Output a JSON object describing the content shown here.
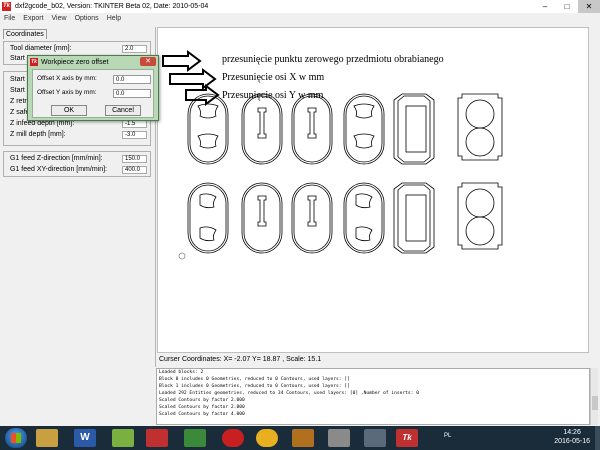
{
  "window": {
    "title": "dxf2gcode_b02, Version: TKINTER Beta 02, Date: 2010-05-04",
    "app_icon": "Tk",
    "minimize_icon": "–",
    "maximize_icon": "□",
    "close_icon": "✕"
  },
  "menu": [
    "File",
    "Export",
    "View",
    "Options",
    "Help"
  ],
  "left_panel": {
    "tab": "Coordinates",
    "group1": [
      {
        "label": "Tool diameter [mm]:",
        "value": "2.0"
      },
      {
        "label": "Start r",
        "value": ""
      }
    ],
    "group2": [
      {
        "label": "Start a",
        "value": ""
      },
      {
        "label": "Start a",
        "value": ""
      },
      {
        "label": "Z retra",
        "value": ""
      },
      {
        "label": "Z safe",
        "value": ""
      },
      {
        "label": "Z infeed depth [mm]:",
        "value": "-1.5"
      },
      {
        "label": "Z mill depth [mm]:",
        "value": "-3.0"
      }
    ],
    "group3": [
      {
        "label": "G1 feed Z-direction [mm/min]:",
        "value": "150.0"
      },
      {
        "label": "G1 feed XY-direction [mm/min]:",
        "value": "400.0"
      }
    ]
  },
  "dialog": {
    "title": "Workpiece zero offset",
    "icon": "Tk",
    "close_icon": "✕",
    "fields": [
      {
        "label": "Offset X axis by mm:",
        "value": "0.0"
      },
      {
        "label": "Offset Y axis by mm:",
        "value": "0.0"
      }
    ],
    "ok_label": "OK",
    "cancel_label": "Cancel"
  },
  "annotations": [
    "przesunięcie punktu zerowego przedmiotu obrabianego",
    "Przesunięcie osi X w mm",
    "Przesunięcie osi Y w mm"
  ],
  "status": "Curser Coordinates: X= -2.07 Y= 18.87 , Scale: 15.1",
  "log_lines": [
    "Loaded blocks: 2",
    "Block 0 includes 0 Geometries, reduced to 0 Contours, used layers: []",
    "Block 1 includes 0 Geometries, reduced to 0 Contours, used layers: []",
    "Loaded 292 Entities geometries, reduced to 34 Contours, used layers: [0] ,Number of inserts: 0",
    "Scaled Contours by factor 2.000",
    "Scaled Contours by factor 2.000",
    "Scaled Contours by factor 4.000"
  ],
  "taskbar": {
    "items": [
      "W",
      "Tk"
    ],
    "language": "PL",
    "time": "14:26",
    "date": "2016-05-16",
    "colors": [
      "#c8a040",
      "#2a5aa8",
      "#7ab040",
      "#c03030",
      "#3a8a3a",
      "#c82020",
      "#e8b020",
      "#b07020",
      "#8a8a8a",
      "#c03030"
    ]
  }
}
